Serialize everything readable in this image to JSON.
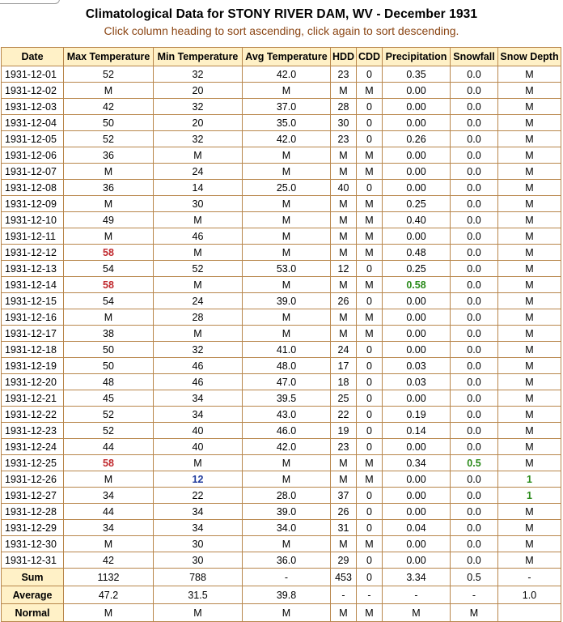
{
  "page": {
    "title": "Climatological Data for STONY RIVER DAM, WV - December 1931",
    "subtitle": "Click column heading to sort ascending, click again to sort descending."
  },
  "table": {
    "headers": [
      "Date",
      "Max Temperature",
      "Min Temperature",
      "Avg Temperature",
      "HDD",
      "CDD",
      "Precipitation",
      "Snowfall",
      "Snow Depth"
    ],
    "rows": [
      [
        "1931-12-01",
        "52",
        "32",
        "42.0",
        "23",
        "0",
        "0.35",
        "0.0",
        "M"
      ],
      [
        "1931-12-02",
        "M",
        "20",
        "M",
        "M",
        "M",
        "0.00",
        "0.0",
        "M"
      ],
      [
        "1931-12-03",
        "42",
        "32",
        "37.0",
        "28",
        "0",
        "0.00",
        "0.0",
        "M"
      ],
      [
        "1931-12-04",
        "50",
        "20",
        "35.0",
        "30",
        "0",
        "0.00",
        "0.0",
        "M"
      ],
      [
        "1931-12-05",
        "52",
        "32",
        "42.0",
        "23",
        "0",
        "0.26",
        "0.0",
        "M"
      ],
      [
        "1931-12-06",
        "36",
        "M",
        "M",
        "M",
        "M",
        "0.00",
        "0.0",
        "M"
      ],
      [
        "1931-12-07",
        "M",
        "24",
        "M",
        "M",
        "M",
        "0.00",
        "0.0",
        "M"
      ],
      [
        "1931-12-08",
        "36",
        "14",
        "25.0",
        "40",
        "0",
        "0.00",
        "0.0",
        "M"
      ],
      [
        "1931-12-09",
        "M",
        "30",
        "M",
        "M",
        "M",
        "0.25",
        "0.0",
        "M"
      ],
      [
        "1931-12-10",
        "49",
        "M",
        "M",
        "M",
        "M",
        "0.40",
        "0.0",
        "M"
      ],
      [
        "1931-12-11",
        "M",
        "46",
        "M",
        "M",
        "M",
        "0.00",
        "0.0",
        "M"
      ],
      [
        "1931-12-12",
        "58",
        "M",
        "M",
        "M",
        "M",
        "0.48",
        "0.0",
        "M"
      ],
      [
        "1931-12-13",
        "54",
        "52",
        "53.0",
        "12",
        "0",
        "0.25",
        "0.0",
        "M"
      ],
      [
        "1931-12-14",
        "58",
        "M",
        "M",
        "M",
        "M",
        "0.58",
        "0.0",
        "M"
      ],
      [
        "1931-12-15",
        "54",
        "24",
        "39.0",
        "26",
        "0",
        "0.00",
        "0.0",
        "M"
      ],
      [
        "1931-12-16",
        "M",
        "28",
        "M",
        "M",
        "M",
        "0.00",
        "0.0",
        "M"
      ],
      [
        "1931-12-17",
        "38",
        "M",
        "M",
        "M",
        "M",
        "0.00",
        "0.0",
        "M"
      ],
      [
        "1931-12-18",
        "50",
        "32",
        "41.0",
        "24",
        "0",
        "0.00",
        "0.0",
        "M"
      ],
      [
        "1931-12-19",
        "50",
        "46",
        "48.0",
        "17",
        "0",
        "0.03",
        "0.0",
        "M"
      ],
      [
        "1931-12-20",
        "48",
        "46",
        "47.0",
        "18",
        "0",
        "0.03",
        "0.0",
        "M"
      ],
      [
        "1931-12-21",
        "45",
        "34",
        "39.5",
        "25",
        "0",
        "0.00",
        "0.0",
        "M"
      ],
      [
        "1931-12-22",
        "52",
        "34",
        "43.0",
        "22",
        "0",
        "0.19",
        "0.0",
        "M"
      ],
      [
        "1931-12-23",
        "52",
        "40",
        "46.0",
        "19",
        "0",
        "0.14",
        "0.0",
        "M"
      ],
      [
        "1931-12-24",
        "44",
        "40",
        "42.0",
        "23",
        "0",
        "0.00",
        "0.0",
        "M"
      ],
      [
        "1931-12-25",
        "58",
        "M",
        "M",
        "M",
        "M",
        "0.34",
        "0.5",
        "M"
      ],
      [
        "1931-12-26",
        "M",
        "12",
        "M",
        "M",
        "M",
        "0.00",
        "0.0",
        "1"
      ],
      [
        "1931-12-27",
        "34",
        "22",
        "28.0",
        "37",
        "0",
        "0.00",
        "0.0",
        "1"
      ],
      [
        "1931-12-28",
        "44",
        "34",
        "39.0",
        "26",
        "0",
        "0.00",
        "0.0",
        "M"
      ],
      [
        "1931-12-29",
        "34",
        "34",
        "34.0",
        "31",
        "0",
        "0.04",
        "0.0",
        "M"
      ],
      [
        "1931-12-30",
        "M",
        "30",
        "M",
        "M",
        "M",
        "0.00",
        "0.0",
        "M"
      ],
      [
        "1931-12-31",
        "42",
        "30",
        "36.0",
        "29",
        "0",
        "0.00",
        "0.0",
        "M"
      ]
    ],
    "highlights": [
      {
        "row": 11,
        "col": 1,
        "style": "red"
      },
      {
        "row": 13,
        "col": 1,
        "style": "red"
      },
      {
        "row": 24,
        "col": 1,
        "style": "red"
      },
      {
        "row": 25,
        "col": 2,
        "style": "blue"
      },
      {
        "row": 13,
        "col": 6,
        "style": "green"
      },
      {
        "row": 24,
        "col": 7,
        "style": "green"
      },
      {
        "row": 25,
        "col": 8,
        "style": "green"
      },
      {
        "row": 26,
        "col": 8,
        "style": "green"
      }
    ],
    "summary": [
      [
        "Sum",
        "1132",
        "788",
        "-",
        "453",
        "0",
        "3.34",
        "0.5",
        "-"
      ],
      [
        "Average",
        "47.2",
        "31.5",
        "39.8",
        "-",
        "-",
        "-",
        "-",
        "1.0"
      ],
      [
        "Normal",
        "M",
        "M",
        "M",
        "M",
        "M",
        "M",
        "M",
        ""
      ]
    ]
  },
  "colors": {
    "header_bg": "#fff1c7",
    "border": "#b8864b",
    "subtitle": "#8b4513",
    "max_red": "#c0282d",
    "min_blue": "#1f3a9c",
    "max_green": "#2a8a1a"
  }
}
